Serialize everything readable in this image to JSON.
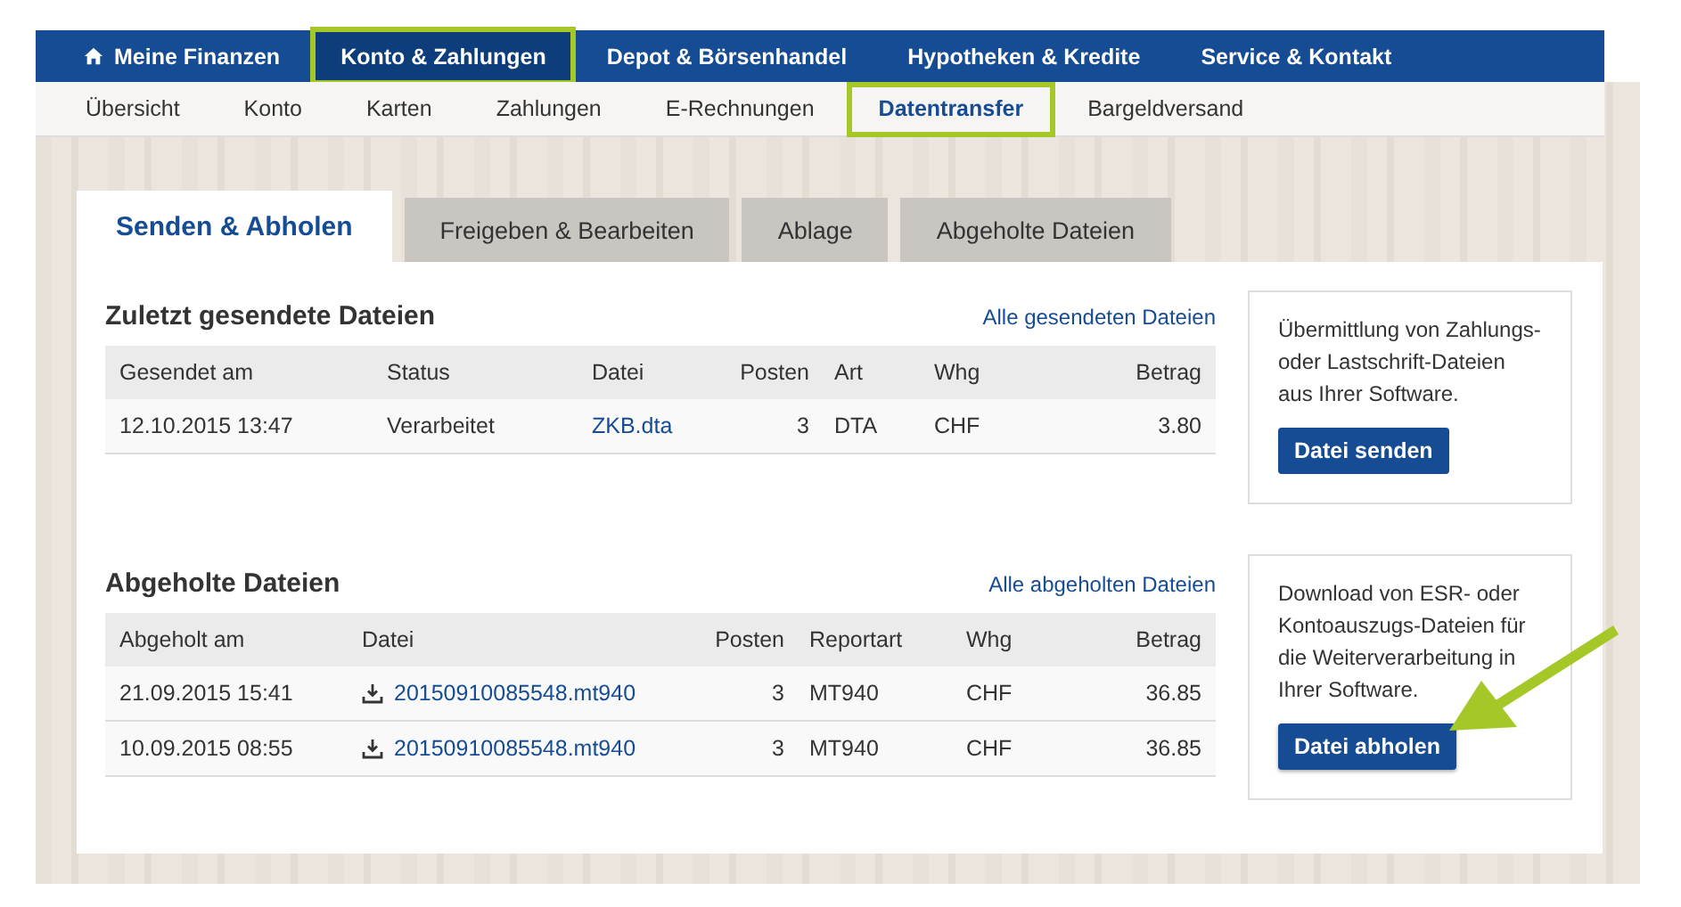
{
  "main_nav": [
    {
      "label": "Meine Finanzen",
      "kind": "home",
      "selected": false,
      "highlighted": false
    },
    {
      "label": "Konto & Zahlungen",
      "kind": "plain",
      "selected": true,
      "highlighted": true
    },
    {
      "label": "Depot & Börsenhandel",
      "kind": "plain",
      "selected": false,
      "highlighted": false
    },
    {
      "label": "Hypotheken & Kredite",
      "kind": "plain",
      "selected": false,
      "highlighted": false
    },
    {
      "label": "Service & Kontakt",
      "kind": "plain",
      "selected": false,
      "highlighted": false
    }
  ],
  "sub_nav": [
    {
      "label": "Übersicht",
      "selected": false,
      "highlighted": false
    },
    {
      "label": "Konto",
      "selected": false,
      "highlighted": false
    },
    {
      "label": "Karten",
      "selected": false,
      "highlighted": false
    },
    {
      "label": "Zahlungen",
      "selected": false,
      "highlighted": false
    },
    {
      "label": "E-Rechnungen",
      "selected": false,
      "highlighted": false
    },
    {
      "label": "Datentransfer",
      "selected": true,
      "highlighted": true
    },
    {
      "label": "Bargeldversand",
      "selected": false,
      "highlighted": false
    }
  ],
  "tabs": [
    {
      "label": "Senden & Abholen",
      "selected": true
    },
    {
      "label": "Freigeben & Bearbeiten",
      "selected": false
    },
    {
      "label": "Ablage",
      "selected": false
    },
    {
      "label": "Abgeholte Dateien",
      "selected": false
    }
  ],
  "sections": [
    {
      "title": "Zuletzt gesendete Dateien",
      "link": "Alle gesendeten Dateien",
      "columns": [
        {
          "label": "Gesendet am",
          "kind": "text"
        },
        {
          "label": "Status",
          "kind": "text"
        },
        {
          "label": "Datei",
          "kind": "link"
        },
        {
          "label": "Posten",
          "kind": "number"
        },
        {
          "label": "Art",
          "kind": "text"
        },
        {
          "label": "Whg",
          "kind": "text"
        },
        {
          "label": "Betrag",
          "kind": "number"
        }
      ],
      "rows": [
        [
          "12.10.2015 13:47",
          "Verarbeitet",
          "ZKB.dta",
          "3",
          "DTA",
          "CHF",
          "3.80"
        ]
      ],
      "info": {
        "text": "Übermittlung von Zahlungs- oder Lastschrift-Dateien aus Ihrer Software.",
        "button": "Datei senden",
        "pointed_at": false
      }
    },
    {
      "title": "Abgeholte Dateien",
      "link": "Alle abgeholten Dateien",
      "columns": [
        {
          "label": "Abgeholt am",
          "kind": "text"
        },
        {
          "label": "Datei",
          "kind": "download"
        },
        {
          "label": "Posten",
          "kind": "number"
        },
        {
          "label": "Reportart",
          "kind": "text"
        },
        {
          "label": "Whg",
          "kind": "text"
        },
        {
          "label": "Betrag",
          "kind": "number"
        }
      ],
      "rows": [
        [
          "21.09.2015 15:41",
          "20150910085548.mt940",
          "3",
          "MT940",
          "CHF",
          "36.85"
        ],
        [
          "10.09.2015 08:55",
          "20150910085548.mt940",
          "3",
          "MT940",
          "CHF",
          "36.85"
        ]
      ],
      "info": {
        "text": "Download von ESR- oder Kontoauszugs-Dateien für die Weiterverarbeitung in Ihrer Software.",
        "button": "Datei abholen",
        "pointed_at": true
      }
    }
  ]
}
